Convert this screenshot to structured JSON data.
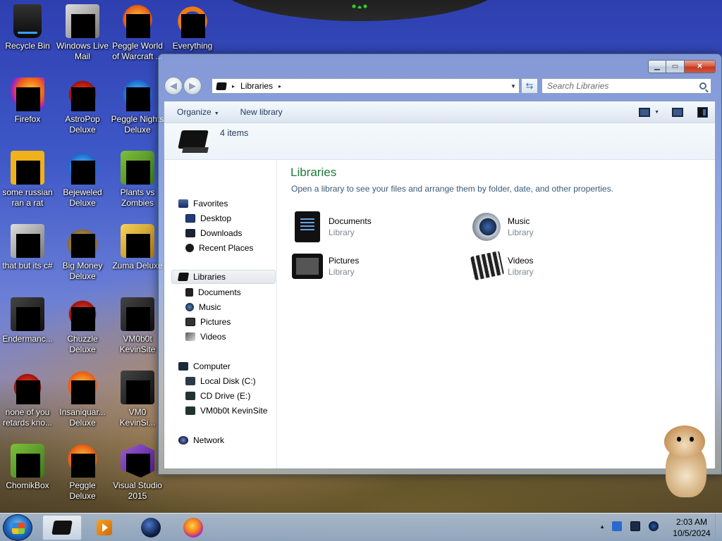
{
  "desktop": {
    "icons": [
      {
        "label": "Recycle Bin",
        "icon": "recycle-bin-icon"
      },
      {
        "label": "Windows Live Mail",
        "icon": "mail-icon"
      },
      {
        "label": "Peggle World of Warcraft ...",
        "icon": "peggle-wow-icon"
      },
      {
        "label": "Everything",
        "icon": "everything-icon"
      },
      {
        "label": "Firefox",
        "icon": "firefox-icon"
      },
      {
        "label": "AstroPop Deluxe",
        "icon": "astropop-icon"
      },
      {
        "label": "Peggle Nights Deluxe",
        "icon": "peggle-nights-icon"
      },
      {
        "label": "some russian ran a rat",
        "icon": "app-icon"
      },
      {
        "label": "Bejeweled Deluxe",
        "icon": "bejeweled-icon"
      },
      {
        "label": "Plants vs Zombies",
        "icon": "pvz-icon"
      },
      {
        "label": "that but its c#",
        "icon": "shortcut-icon"
      },
      {
        "label": "Big Money Deluxe",
        "icon": "bigmoney-icon"
      },
      {
        "label": "Zuma Deluxe",
        "icon": "zuma-icon"
      },
      {
        "label": "Endermanc...",
        "icon": "app-icon"
      },
      {
        "label": "Chuzzle Deluxe",
        "icon": "chuzzle-icon"
      },
      {
        "label": "VM0b0t KevinSite",
        "icon": "app-icon"
      },
      {
        "label": "none of you retards kno...",
        "icon": "app-icon"
      },
      {
        "label": "Insaniquar... Deluxe",
        "icon": "insaniquarium-icon"
      },
      {
        "label": "VM0 KevinSi...",
        "icon": "app-icon"
      },
      {
        "label": "ChomikBox",
        "icon": "chomikbox-icon"
      },
      {
        "label": "Peggle Deluxe",
        "icon": "peggle-icon"
      },
      {
        "label": "Visual Studio 2015",
        "icon": "visual-studio-icon"
      }
    ]
  },
  "window": {
    "address": {
      "crumb": "Libraries",
      "chevron": "▸"
    },
    "search": {
      "placeholder": "Search Libraries"
    },
    "commands": {
      "organize": "Organize",
      "new_library": "New library"
    },
    "details": {
      "count": "4 items"
    },
    "nav": {
      "favorites": "Favorites",
      "desktop": "Desktop",
      "downloads": "Downloads",
      "recent": "Recent Places",
      "libraries": "Libraries",
      "documents": "Documents",
      "music": "Music",
      "pictures": "Pictures",
      "videos": "Videos",
      "computer": "Computer",
      "local_disk": "Local Disk (C:)",
      "cd_drive": "CD Drive (E:)",
      "vm_share": "VM0b0t KevinSite",
      "network": "Network"
    },
    "main": {
      "title": "Libraries",
      "subtitle": "Open a library to see your files and arrange them by folder, date, and other properties.",
      "items": [
        {
          "name": "Documents",
          "type": "Library"
        },
        {
          "name": "Music",
          "type": "Library"
        },
        {
          "name": "Pictures",
          "type": "Library"
        },
        {
          "name": "Videos",
          "type": "Library"
        }
      ]
    }
  },
  "taskbar": {
    "clock_time": "2:03 AM",
    "clock_date": "10/5/2024",
    "tray_caret": "▲"
  },
  "colors": {
    "library_title": "#1e7a3a",
    "window_close": "#c2371f"
  }
}
